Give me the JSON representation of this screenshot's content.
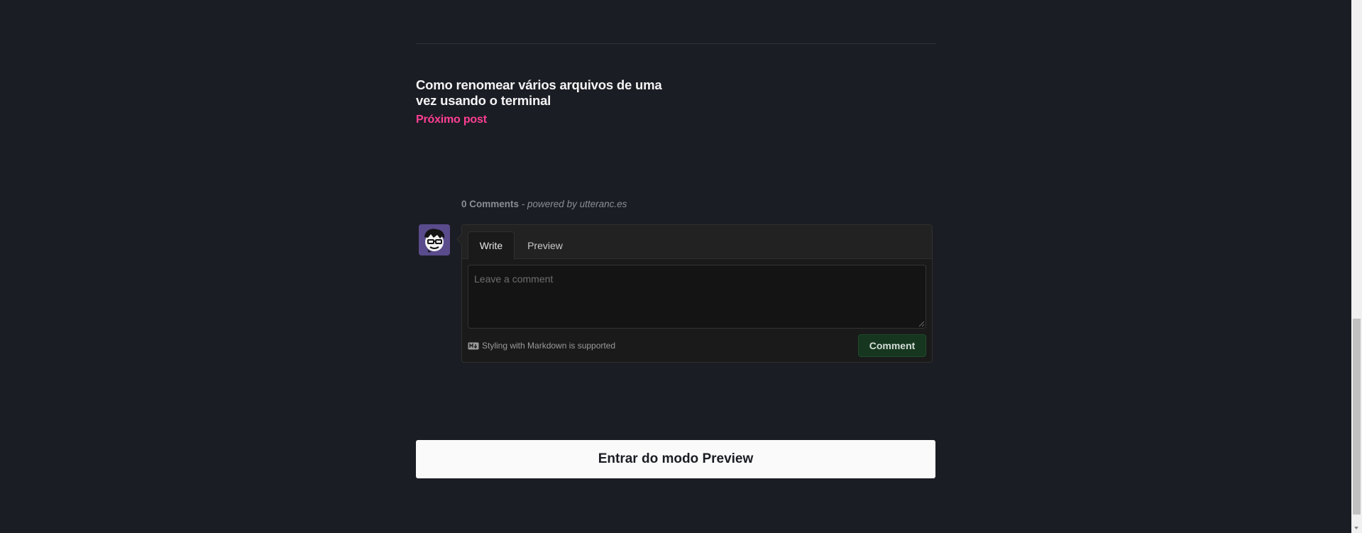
{
  "next_post": {
    "title": "Como renomear vários arquivos de uma vez usando o terminal",
    "label": "Próximo post"
  },
  "comments": {
    "count_label": "0 Comments",
    "separator": " - ",
    "powered_by": "powered by utteranc.es",
    "tabs": {
      "write": "Write",
      "preview": "Preview"
    },
    "textarea_placeholder": "Leave a comment",
    "textarea_value": "",
    "markdown_hint": "Styling with Markdown is supported",
    "submit_label": "Comment"
  },
  "preview_mode_button": "Entrar do modo Preview",
  "colors": {
    "background": "#1b1d24",
    "accent_pink": "#ff3f94",
    "comment_button_bg": "#16361f",
    "avatar_bg": "#5a4b8c"
  },
  "icons": {
    "avatar": "user-avatar-icon",
    "markdown": "markdown-icon",
    "resize": "resize-grip-icon",
    "scroll_down": "scroll-down-arrow-icon"
  }
}
